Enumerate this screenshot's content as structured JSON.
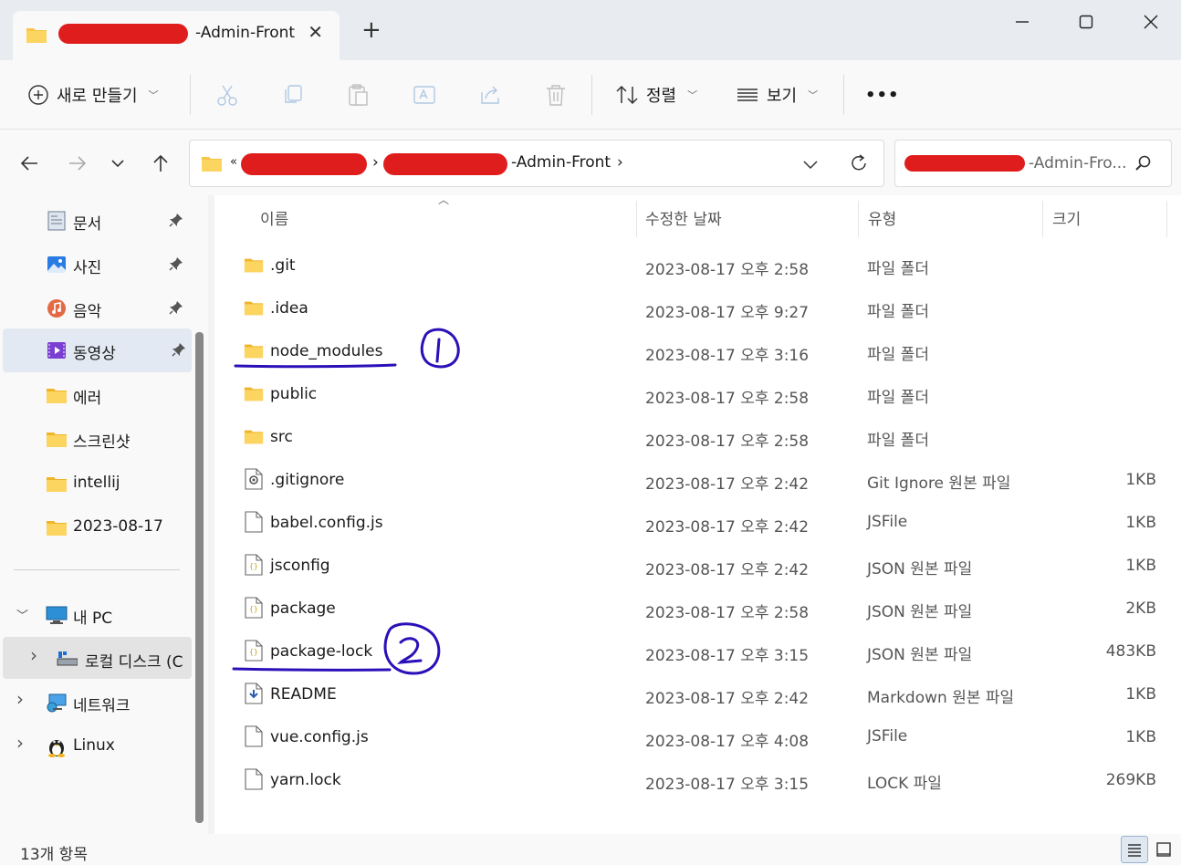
{
  "window": {
    "tab_title": "-Admin-Front",
    "new_tab": "+",
    "close_tab": "✕"
  },
  "toolbar": {
    "new_label": "새로 만들기",
    "sort_label": "정렬",
    "view_label": "보기",
    "more_label": "•••"
  },
  "address": {
    "prefix": "«",
    "segment_last": "-Admin-Front",
    "search_suffix": "-Admin-Fro..."
  },
  "sidebar": {
    "quick": [
      {
        "label": "문서",
        "icon": "documents-icon",
        "pinned": true
      },
      {
        "label": "사진",
        "icon": "pictures-icon",
        "pinned": true
      },
      {
        "label": "음악",
        "icon": "music-icon",
        "pinned": true
      },
      {
        "label": "동영상",
        "icon": "videos-icon",
        "pinned": true
      },
      {
        "label": "에러",
        "icon": "folder-icon",
        "pinned": false
      },
      {
        "label": "스크린샷",
        "icon": "folder-icon",
        "pinned": false
      },
      {
        "label": "intellij",
        "icon": "folder-icon",
        "pinned": false
      },
      {
        "label": "2023-08-17",
        "icon": "folder-icon",
        "pinned": false
      }
    ],
    "tree": [
      {
        "label": "내 PC",
        "icon": "pc-icon",
        "expanded": true
      },
      {
        "label": "로컬 디스크 (C",
        "icon": "drive-icon",
        "expanded": false
      },
      {
        "label": "네트워크",
        "icon": "network-icon",
        "expanded": false
      },
      {
        "label": "Linux",
        "icon": "linux-icon",
        "expanded": false
      }
    ]
  },
  "columns": {
    "name": "이름",
    "date": "수정한 날짜",
    "type": "유형",
    "size": "크기"
  },
  "files": [
    {
      "name": ".git",
      "date": "2023-08-17 오후 2:58",
      "type": "파일 폴더",
      "size": "",
      "kind": "folder"
    },
    {
      "name": ".idea",
      "date": "2023-08-17 오후 9:27",
      "type": "파일 폴더",
      "size": "",
      "kind": "folder"
    },
    {
      "name": "node_modules",
      "date": "2023-08-17 오후 3:16",
      "type": "파일 폴더",
      "size": "",
      "kind": "folder"
    },
    {
      "name": "public",
      "date": "2023-08-17 오후 2:58",
      "type": "파일 폴더",
      "size": "",
      "kind": "folder"
    },
    {
      "name": "src",
      "date": "2023-08-17 오후 2:58",
      "type": "파일 폴더",
      "size": "",
      "kind": "folder"
    },
    {
      "name": ".gitignore",
      "date": "2023-08-17 오후 2:42",
      "type": "Git Ignore 원본 파일",
      "size": "1KB",
      "kind": "gear"
    },
    {
      "name": "babel.config.js",
      "date": "2023-08-17 오후 2:42",
      "type": "JSFile",
      "size": "1KB",
      "kind": "file"
    },
    {
      "name": "jsconfig",
      "date": "2023-08-17 오후 2:42",
      "type": "JSON 원본 파일",
      "size": "1KB",
      "kind": "json"
    },
    {
      "name": "package",
      "date": "2023-08-17 오후 2:58",
      "type": "JSON 원본 파일",
      "size": "2KB",
      "kind": "json"
    },
    {
      "name": "package-lock",
      "date": "2023-08-17 오후 3:15",
      "type": "JSON 원본 파일",
      "size": "483KB",
      "kind": "json"
    },
    {
      "name": "README",
      "date": "2023-08-17 오후 2:42",
      "type": "Markdown 원본 파일",
      "size": "1KB",
      "kind": "markdown"
    },
    {
      "name": "vue.config.js",
      "date": "2023-08-17 오후 4:08",
      "type": "JSFile",
      "size": "1KB",
      "kind": "file"
    },
    {
      "name": "yarn.lock",
      "date": "2023-08-17 오후 3:15",
      "type": "LOCK 파일",
      "size": "269KB",
      "kind": "file"
    }
  ],
  "status": {
    "count": "13개 항목"
  },
  "colors": {
    "folder": "#f7c548",
    "redaction": "#e01d1d",
    "annotation": "#2a10b8",
    "selected": "#e2e9f2"
  }
}
